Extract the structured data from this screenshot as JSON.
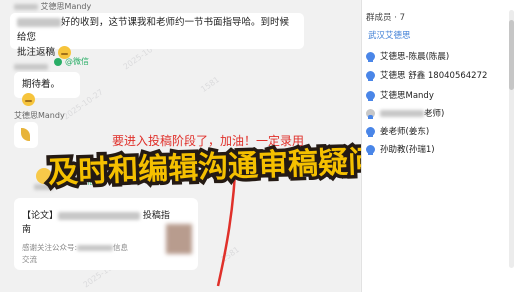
{
  "chat": {
    "msg1_sender": "艾德思Mandy",
    "msg1_text_a": "好的收到，这节课我和老师约一节书面指导哈。到时候给您",
    "msg1_text_b": "批注返稿",
    "wechat_label": "@微信",
    "msg2_text": "期待着。",
    "msg3_sender": "艾德思Mandy",
    "card_title_a": "【论文】",
    "card_title_b": "投稿指",
    "card_title_c": "南",
    "card_sub_a": "感谢关注公众号:",
    "card_sub_b": "信息",
    "card_sub_c": "交流",
    "overlay_red": "要进入投稿阶段了，加油！一定录用",
    "big_title": "及时和编辑沟通审稿疑问",
    "watermarks": [
      "2025-10-27",
      "2025-10-27",
      "1581",
      "2025-10-27",
      "1581"
    ]
  },
  "members": {
    "header": "群成员 · 7",
    "items": [
      {
        "label": "武汉艾德思",
        "color": "#3f7fd6"
      },
      {
        "label": "艾德思-陈晨(陈晨)",
        "color": "#222222"
      },
      {
        "label": "艾德思 舒鑫 18040564272",
        "color": "#222222"
      },
      {
        "label": "艾德思Mandy",
        "color": "#222222"
      },
      {
        "label": "老师)",
        "color": "#222222"
      },
      {
        "label": "姜老师(姜东)",
        "color": "#222222"
      },
      {
        "label": "孙助教(孙瑞1)",
        "color": "#222222"
      }
    ]
  }
}
